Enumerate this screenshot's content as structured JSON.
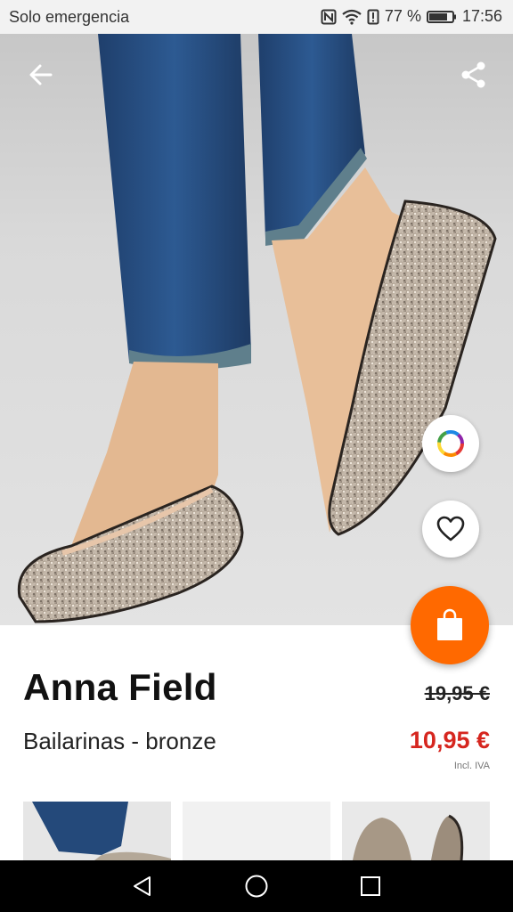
{
  "status_bar": {
    "carrier": "Solo emergencia",
    "battery": "77 %",
    "time": "17:56"
  },
  "icons": {
    "back": "arrow-left",
    "share": "share",
    "color": "color-ring",
    "favorite": "heart-outline",
    "bag": "shopping-bag"
  },
  "product": {
    "brand": "Anna Field",
    "name": "Bailarinas - bronze",
    "old_price": "19,95 €",
    "price": "10,95 €",
    "tax_note": "Incl. IVA"
  },
  "colors": {
    "accent": "#ff6900",
    "sale_price": "#d6261f"
  }
}
